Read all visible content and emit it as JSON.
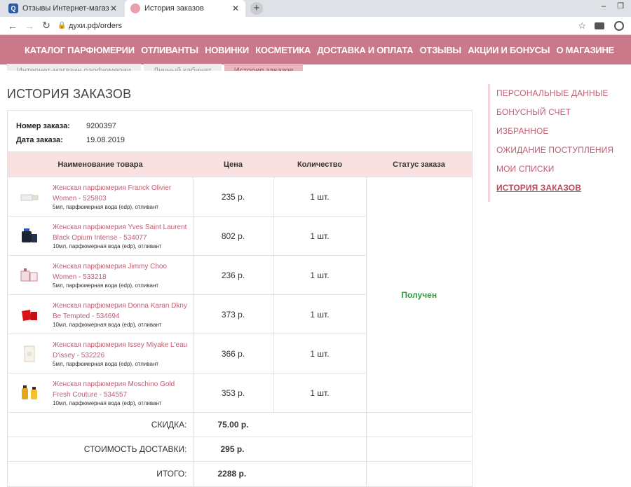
{
  "browser": {
    "tabs": [
      {
        "label": "Отзывы Интернет-магазин пар",
        "active": false
      },
      {
        "label": "История заказов",
        "active": true
      }
    ],
    "url": "духи.рф/orders"
  },
  "nav": {
    "items": [
      "КАТАЛОГ ПАРФЮМЕРИИ",
      "ОТЛИВАНТЫ",
      "НОВИНКИ",
      "КОСМЕТИКА",
      "ДОСТАВКА И ОПЛАТА",
      "ОТЗЫВЫ",
      "АКЦИИ И БОНУСЫ",
      "О МАГАЗИНЕ"
    ]
  },
  "breadcrumbs": [
    "Интернет-магазин парфюмерии",
    "Личный кабинет",
    "История заказов"
  ],
  "page": {
    "title": "ИСТОРИЯ ЗАКАЗОВ"
  },
  "order": {
    "number_label": "Номер заказа:",
    "number": "9200397",
    "date_label": "Дата заказа:",
    "date": "19.08.2019",
    "columns": [
      "Наименование товара",
      "Цена",
      "Количество",
      "Статус заказа"
    ],
    "status": "Получен",
    "items": [
      {
        "name": "Женская парфюмерия Franck Olivier Women - 525803",
        "desc": "5мл, парфюмерная вода (edp), отливант",
        "price": "235 р.",
        "qty": "1 шт."
      },
      {
        "name": "Женская парфюмерия Yves Saint Laurent Black Opium Intense - 534077",
        "desc": "10мл, парфюмерная вода (edp), отливант",
        "price": "802 р.",
        "qty": "1 шт."
      },
      {
        "name": "Женская парфюмерия Jimmy Choo Women - 533218",
        "desc": "5мл, парфюмерная вода (edp), отливант",
        "price": "236 р.",
        "qty": "1 шт."
      },
      {
        "name": "Женская парфюмерия Donna Karan Dkny Be Tempted - 534694",
        "desc": "10мл, парфюмерная вода (edp), отливант",
        "price": "373 р.",
        "qty": "1 шт."
      },
      {
        "name": "Женская парфюмерия Issey Miyake L'eau D'issey - 532226",
        "desc": "5мл, парфюмерная вода (edp), отливант",
        "price": "366 р.",
        "qty": "1 шт."
      },
      {
        "name": "Женская парфюмерия Moschino Gold Fresh Couture - 534557",
        "desc": "10мл, парфюмерная вода (edp), отливант",
        "price": "353 р.",
        "qty": "1 шт."
      }
    ],
    "discount_label": "СКИДКА:",
    "discount": "75.00 р.",
    "delivery_label": "СТОИМОСТЬ ДОСТАВКИ:",
    "delivery": "295 р.",
    "total_label": "ИТОГО:",
    "total": "2288 р."
  },
  "sidebar": {
    "items": [
      "ПЕРСОНАЛЬНЫЕ ДАННЫЕ",
      "БОНУСНЫЙ СЧЕТ",
      "ИЗБРАННОЕ",
      "ОЖИДАНИЕ ПОСТУПЛЕНИЯ",
      "МОИ СПИСКИ",
      "ИСТОРИЯ ЗАКАЗОВ"
    ],
    "active_index": 5
  },
  "colors": {
    "nav_bg": "#c9798a",
    "link": "#c15e72",
    "header_row": "#fae1e1",
    "status": "#2e9b3a"
  }
}
